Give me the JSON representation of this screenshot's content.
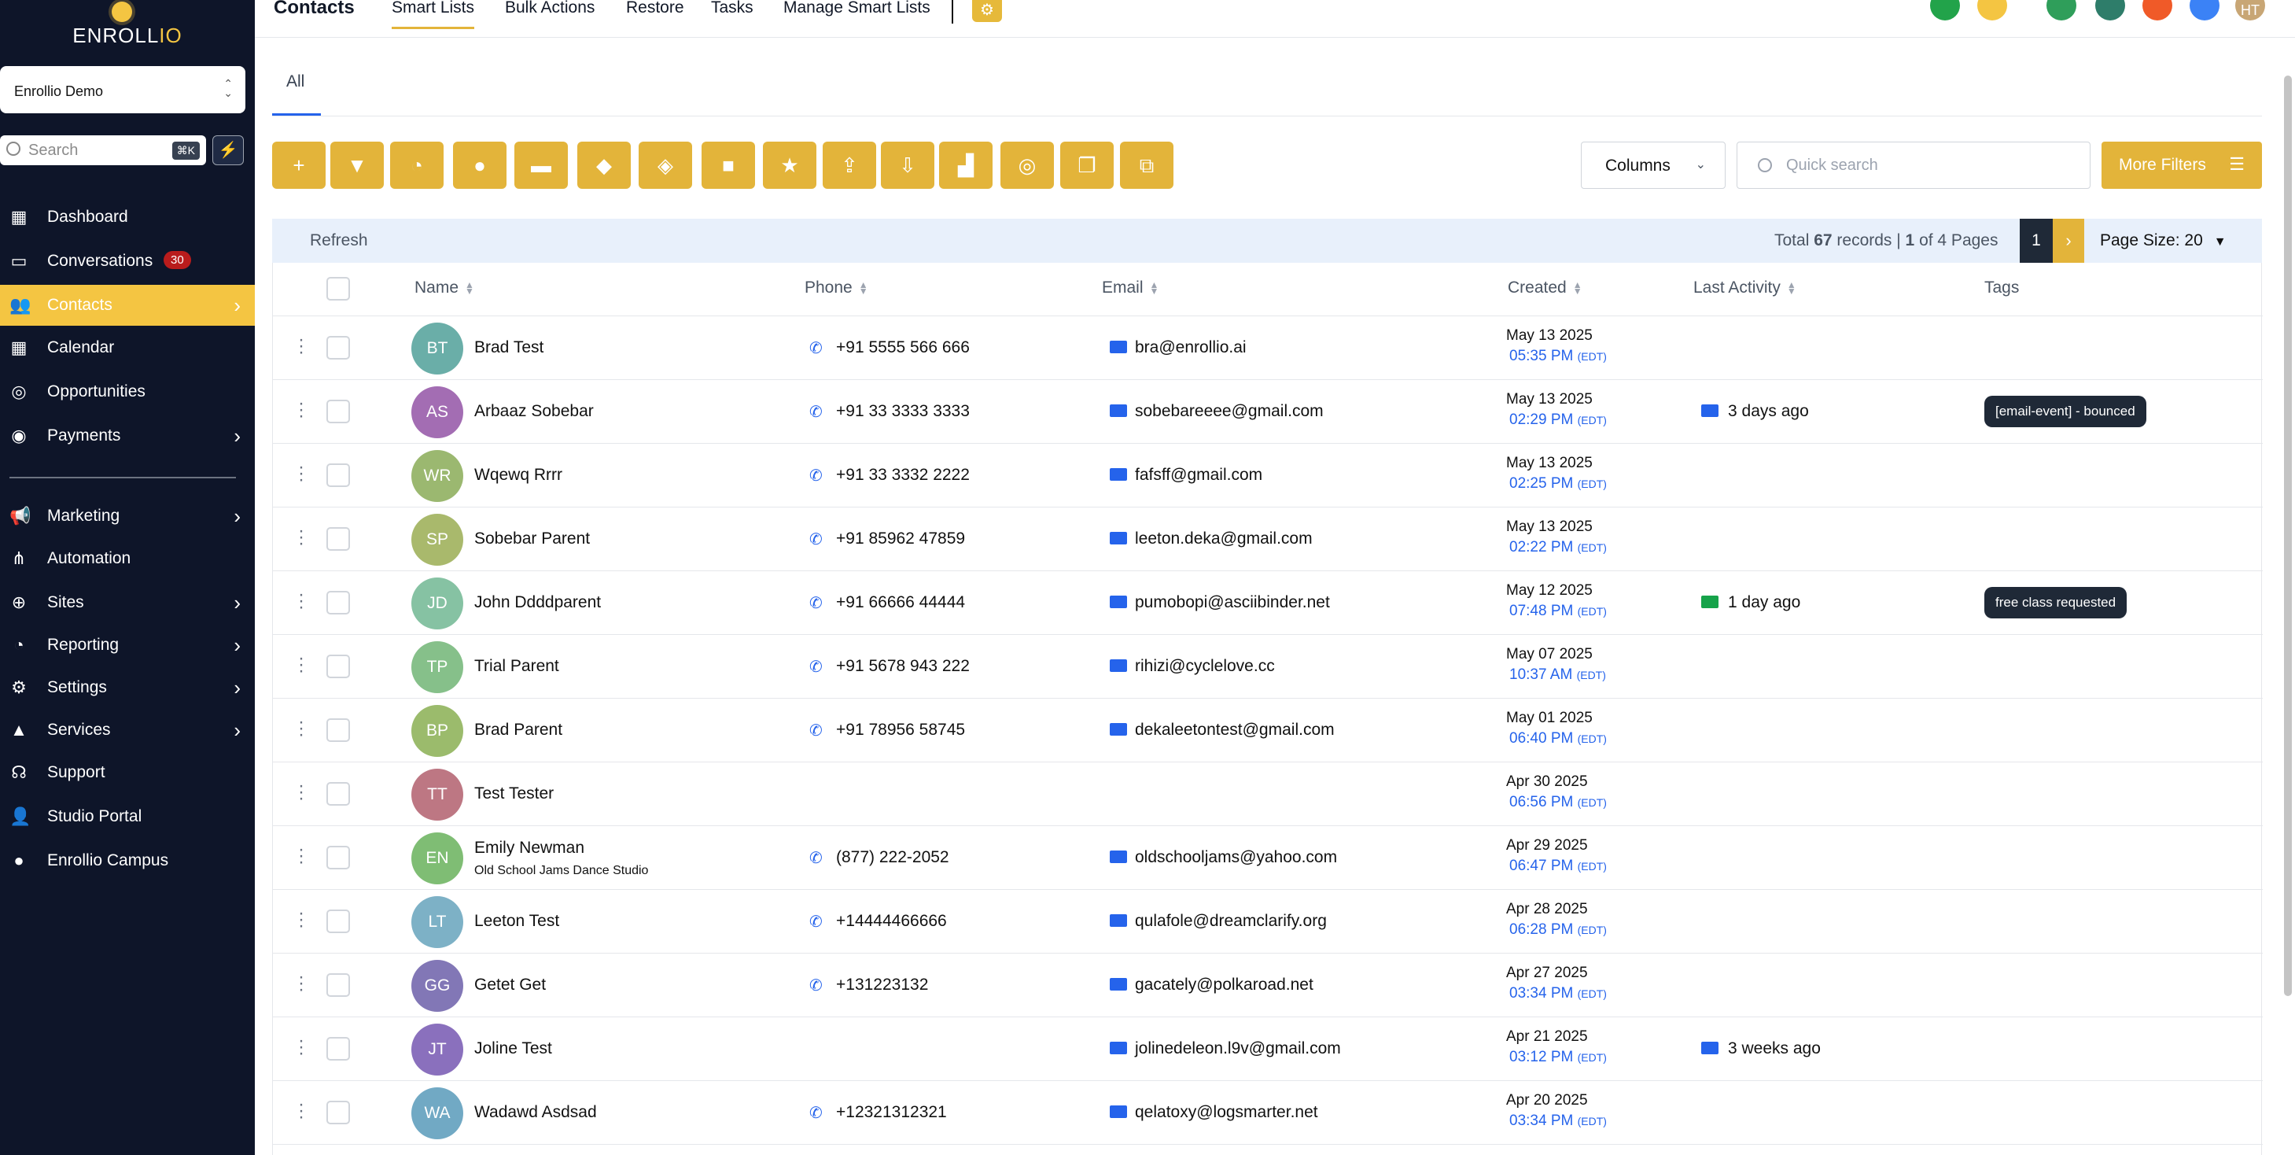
{
  "brand": {
    "logo_text_a": "ENROLL",
    "logo_text_b": "IO",
    "accent": "#e3b43a",
    "sidebar_bg": "#0e1529"
  },
  "sidebar": {
    "account": "Enrollio Demo",
    "search_placeholder": "Search",
    "search_shortcut": "⌘K",
    "items": [
      {
        "label": "Dashboard",
        "icon": "grid-icon"
      },
      {
        "label": "Conversations",
        "icon": "chat-icon",
        "badge": "30"
      },
      {
        "label": "Contacts",
        "icon": "users-icon"
      },
      {
        "label": "Calendar",
        "icon": "calendar-icon"
      },
      {
        "label": "Opportunities",
        "icon": "target-icon"
      },
      {
        "label": "Payments",
        "icon": "money-icon"
      },
      {
        "label": "Marketing",
        "icon": "megaphone-icon"
      },
      {
        "label": "Automation",
        "icon": "flow-icon"
      },
      {
        "label": "Sites",
        "icon": "globe-icon"
      },
      {
        "label": "Reporting",
        "icon": "pie-icon"
      },
      {
        "label": "Settings",
        "icon": "gear-icon"
      },
      {
        "label": "Services",
        "icon": "service-icon"
      },
      {
        "label": "Support",
        "icon": "headset-icon"
      },
      {
        "label": "Studio Portal",
        "icon": "user-icon"
      },
      {
        "label": "Enrollio Campus",
        "icon": "bulb-icon"
      }
    ]
  },
  "topbar": {
    "title": "Contacts",
    "tabs": [
      "Smart Lists",
      "Bulk Actions",
      "Restore",
      "Tasks",
      "Manage Smart Lists"
    ],
    "avatar_initials": "HT"
  },
  "content": {
    "all_tab": "All",
    "columns_label": "Columns",
    "quick_search_placeholder": "Quick search",
    "more_filters": "More Filters",
    "refresh": "Refresh",
    "total_prefix": "Total ",
    "total_records": "67",
    "total_mid": " records | ",
    "current_page": "1",
    "total_suffix": " of 4 Pages",
    "page_size": "Page Size: 20"
  },
  "table": {
    "headers": [
      "Name",
      "Phone",
      "Email",
      "Created",
      "Last Activity",
      "Tags"
    ],
    "rows": [
      {
        "initials": "BT",
        "color": "#6aaea8",
        "name": "Brad Test",
        "phone": "+91 5555 566 666",
        "email": "bra@enrollio.ai",
        "date": "May 13 2025",
        "time": "05:35 PM",
        "tz": "(EDT)"
      },
      {
        "initials": "AS",
        "color": "#a36db3",
        "name": "Arbaaz Sobebar",
        "phone": "+91 33 3333 3333",
        "email": "sobebareeee@gmail.com",
        "date": "May 13 2025",
        "time": "02:29 PM",
        "tz": "(EDT)",
        "activity": "3 days ago",
        "activity_icon": "mail",
        "tag": "[email-event] - bounced"
      },
      {
        "initials": "WR",
        "color": "#9bb870",
        "name": "Wqewq Rrrr",
        "phone": "+91 33 3332 2222",
        "email": "fafsff@gmail.com",
        "date": "May 13 2025",
        "time": "02:25 PM",
        "tz": "(EDT)"
      },
      {
        "initials": "SP",
        "color": "#a9b96c",
        "name": "Sobebar Parent",
        "phone": "+91 85962 47859",
        "email": "leeton.deka@gmail.com",
        "date": "May 13 2025",
        "time": "02:22 PM",
        "tz": "(EDT)"
      },
      {
        "initials": "JD",
        "color": "#86c2a3",
        "name": "John Ddddparent",
        "phone": "+91 66666 44444",
        "email": "pumobopi@asciibinder.net",
        "date": "May 12 2025",
        "time": "07:48 PM",
        "tz": "(EDT)",
        "activity": "1 day ago",
        "activity_icon": "sms",
        "tag": "free class requested"
      },
      {
        "initials": "TP",
        "color": "#86c08a",
        "name": "Trial Parent",
        "phone": "+91 5678 943 222",
        "email": "rihizi@cyclelove.cc",
        "date": "May 07 2025",
        "time": "10:37 AM",
        "tz": "(EDT)"
      },
      {
        "initials": "BP",
        "color": "#9bbb6c",
        "name": "Brad Parent",
        "phone": "+91 78956 58745",
        "email": "dekaleetontest@gmail.com",
        "date": "May 01 2025",
        "time": "06:40 PM",
        "tz": "(EDT)"
      },
      {
        "initials": "TT",
        "color": "#bd7783",
        "name": "Test Tester",
        "phone": "",
        "email": "",
        "date": "Apr 30 2025",
        "time": "06:56 PM",
        "tz": "(EDT)"
      },
      {
        "initials": "EN",
        "color": "#7fbd74",
        "name": "Emily Newman",
        "sub": "Old School Jams Dance Studio",
        "phone": "(877) 222-2052",
        "email": "oldschooljams@yahoo.com",
        "date": "Apr 29 2025",
        "time": "06:47 PM",
        "tz": "(EDT)"
      },
      {
        "initials": "LT",
        "color": "#7db1c6",
        "name": "Leeton Test",
        "phone": "+14444466666",
        "email": "qulafole@dreamclarify.org",
        "date": "Apr 28 2025",
        "time": "06:28 PM",
        "tz": "(EDT)"
      },
      {
        "initials": "GG",
        "color": "#8277b6",
        "name": "Getet Get",
        "phone": "+131223132",
        "email": "gacately@polkaroad.net",
        "date": "Apr 27 2025",
        "time": "03:34 PM",
        "tz": "(EDT)"
      },
      {
        "initials": "JT",
        "color": "#8a70bd",
        "name": "Joline Test",
        "phone": "",
        "email": "jolinedeleon.l9v@gmail.com",
        "date": "Apr 21 2025",
        "time": "03:12 PM",
        "tz": "(EDT)",
        "activity": "3 weeks ago",
        "activity_icon": "mail"
      },
      {
        "initials": "WA",
        "color": "#71a9c4",
        "name": "Wadawd Asdsad",
        "phone": "+12321312321",
        "email": "qelatoxy@logsmarter.net",
        "date": "Apr 20 2025",
        "time": "03:34 PM",
        "tz": "(EDT)"
      }
    ]
  }
}
